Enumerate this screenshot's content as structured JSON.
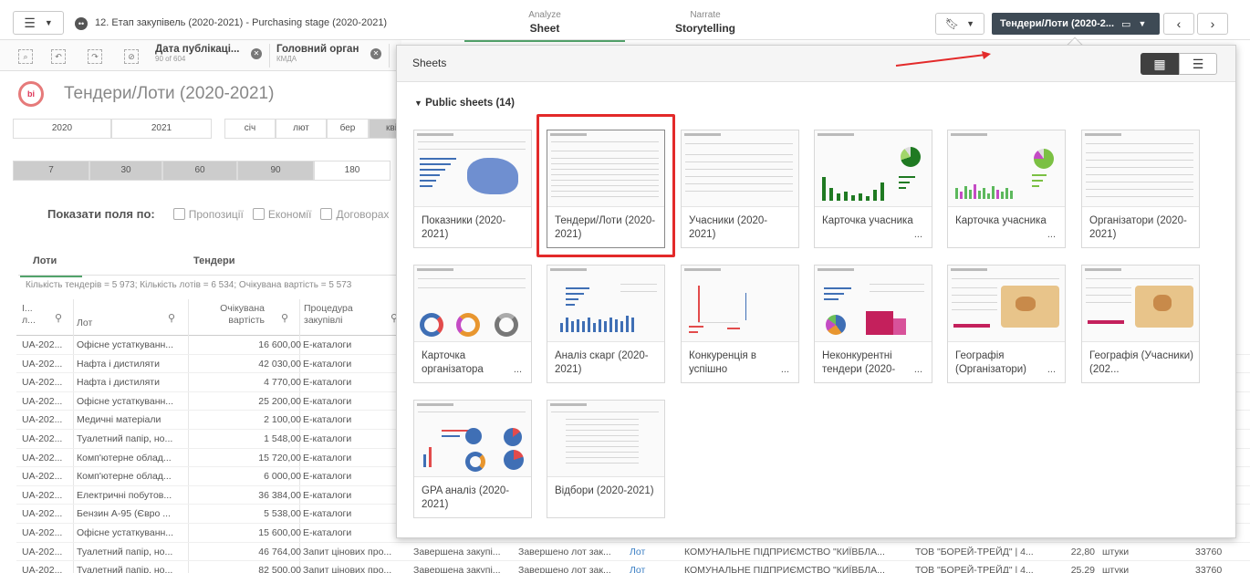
{
  "topbar": {
    "app_title": "12. Етап закупівель (2020-2021) - Purchasing stage (2020-2021)",
    "analyze_small": "Analyze",
    "analyze_big": "Sheet",
    "narrate_small": "Narrate",
    "narrate_big": "Storytelling",
    "current_sheet": "Тендери/Лоти (2020-2..."
  },
  "selections": [
    {
      "title": "Дата публікаці...",
      "sub": "90 of 604"
    },
    {
      "title": "Головний орган",
      "sub": "КМДА"
    }
  ],
  "sheet": {
    "title": "Тендери/Лоти (2020-2021)",
    "years": [
      "2020",
      "2021"
    ],
    "months": [
      "січ",
      "лют",
      "бер",
      "кві"
    ],
    "days": [
      "7",
      "30",
      "60",
      "90",
      "180"
    ],
    "show_fields_label": "Показати поля по:",
    "show_fields": [
      "Пропозиції",
      "Економії",
      "Договорах"
    ],
    "tabs": [
      "Лоти",
      "Тендери"
    ],
    "kpi_line": "Кількість тендерів = 5 973; Кількість лотів = 6 534; Очікувана вартість = 5 573",
    "headers": [
      "І... л...",
      "Лот",
      "Очікувана вартість",
      "Процедура закупівлі"
    ],
    "rows": [
      [
        "UA-202...",
        "Офісне устаткуванн...",
        "16 600,00",
        "Е-каталоги"
      ],
      [
        "UA-202...",
        "Нафта і дистиляти",
        "42 030,00",
        "Е-каталоги"
      ],
      [
        "UA-202...",
        "Нафта і дистиляти",
        "4 770,00",
        "Е-каталоги"
      ],
      [
        "UA-202...",
        "Офісне устаткуванн...",
        "25 200,00",
        "Е-каталоги"
      ],
      [
        "UA-202...",
        "Медичні матеріали",
        "2 100,00",
        "Е-каталоги"
      ],
      [
        "UA-202...",
        "Туалетний папір, но...",
        "1 548,00",
        "Е-каталоги"
      ],
      [
        "UA-202...",
        "Комп'ютерне облад...",
        "15 720,00",
        "Е-каталоги"
      ],
      [
        "UA-202...",
        "Комп'ютерне облад...",
        "6 000,00",
        "Е-каталоги"
      ],
      [
        "UA-202...",
        "Електричні побутов...",
        "36 384,00",
        "Е-каталоги"
      ],
      [
        "UA-202...",
        "Бензин А-95 (Євро ...",
        "5 538,00",
        "Е-каталоги"
      ],
      [
        "UA-202...",
        "Офісне устаткуванн...",
        "15 600,00",
        "Е-каталоги"
      ]
    ],
    "bottom_rows": [
      [
        "UA-202...",
        "Туалетний папір, но...",
        "46 764,00",
        "Запит цінових про...",
        "Завершена закупі...",
        "Завершено лот зак...",
        "Лот",
        "КОМУНАЛЬНЕ ПІДПРИЄМСТВО \"КИЇВБЛА...",
        "ТОВ \"БОРЕЙ-ТРЕЙД\" | 4...",
        "22,80",
        "штуки",
        "33760"
      ],
      [
        "UA-202...",
        "Туалетний папір, но...",
        "82 500,00",
        "Запит цінових про...",
        "Завершена закупі...",
        "Завершено лот зак...",
        "Лот",
        "КОМУНАЛЬНЕ ПІДПРИЄМСТВО \"КИЇВБЛА...",
        "ТОВ \"БОРЕЙ-ТРЕЙД\" | 4...",
        "25,29",
        "штуки",
        "33760"
      ]
    ]
  },
  "panel": {
    "title": "Sheets",
    "section": "Public sheets (14)",
    "cards": [
      {
        "label": "Показники (2020-2021)",
        "more": ""
      },
      {
        "label": "Тендери/Лоти (2020-2021)",
        "more": ""
      },
      {
        "label": "Учасники (2020-2021)",
        "more": ""
      },
      {
        "label": "Карточка учасника",
        "more": "..."
      },
      {
        "label": "Карточка учасника",
        "more": "..."
      },
      {
        "label": "Організатори (2020-2021)",
        "more": ""
      },
      {
        "label": "Карточка організатора",
        "more": "..."
      },
      {
        "label": "Аналіз скарг (2020-2021)",
        "more": ""
      },
      {
        "label": "Конкуренція в успішно",
        "more": "..."
      },
      {
        "label": "Неконкурентні тендери (2020-",
        "more": "..."
      },
      {
        "label": "Географія (Організатори)",
        "more": "..."
      },
      {
        "label": "Географія (Учасники) (202...",
        "more": ""
      },
      {
        "label": "GPA аналіз (2020-2021)",
        "more": ""
      },
      {
        "label": "Відбори (2020-2021)",
        "more": ""
      }
    ]
  },
  "colors": {
    "accent": "#52a36b",
    "highlight": "#e32a2a",
    "sheet_button": "#3e4a55"
  }
}
